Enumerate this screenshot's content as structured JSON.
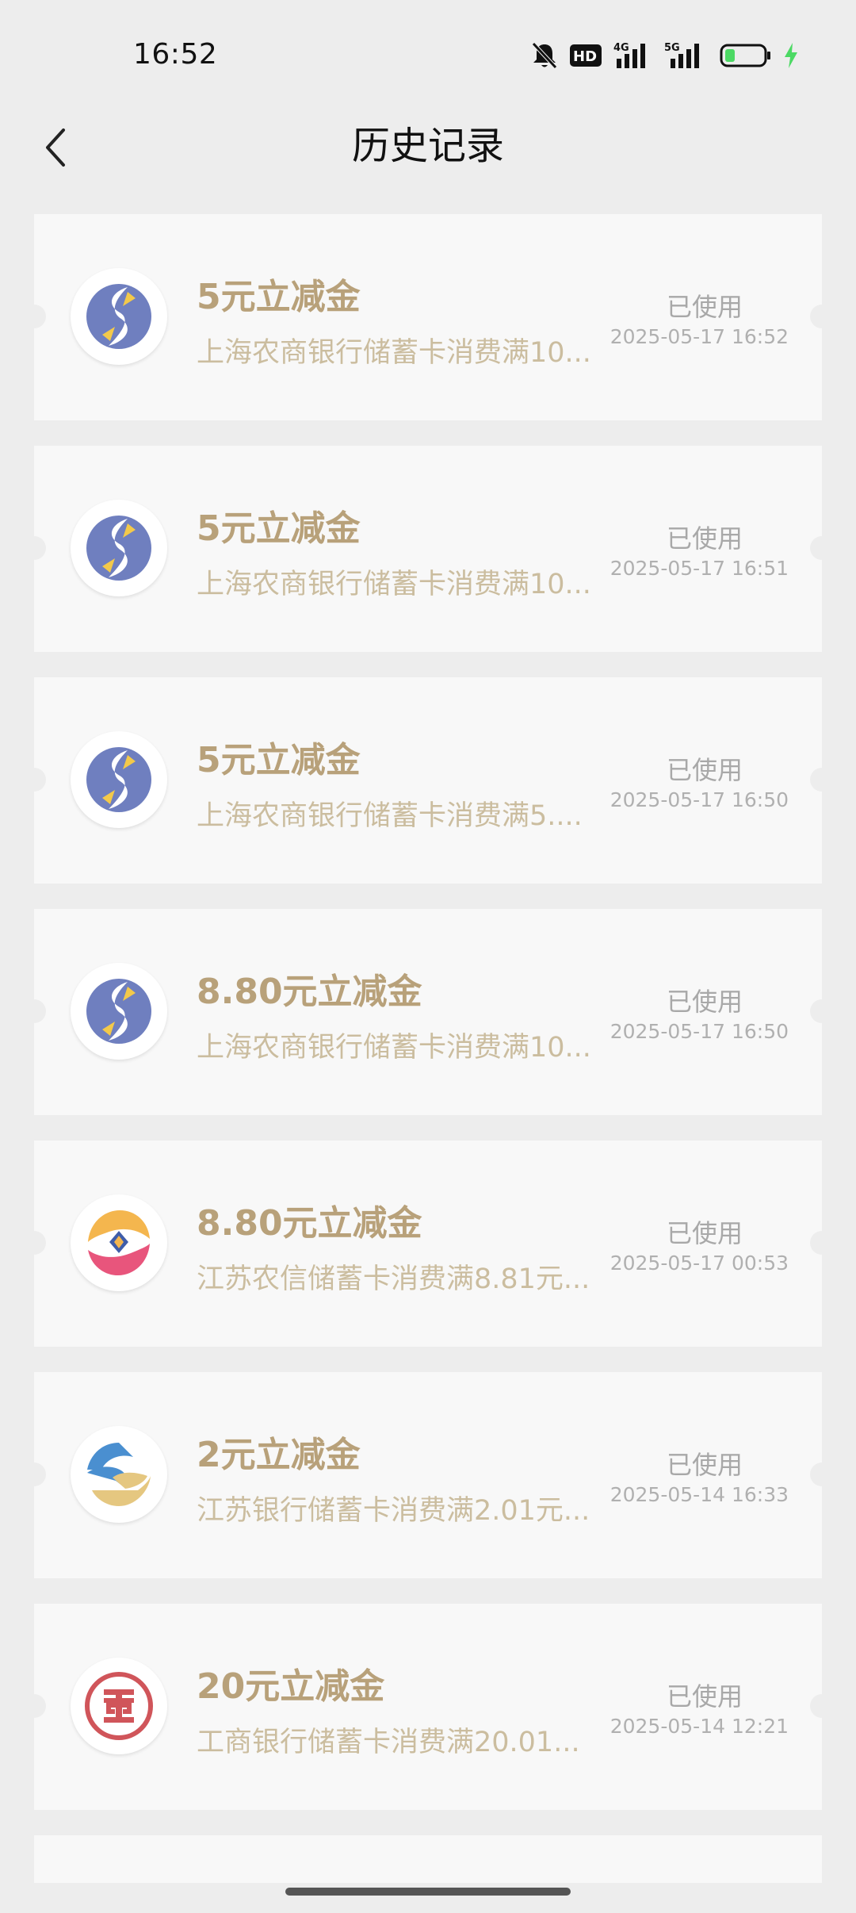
{
  "status_bar": {
    "time": "16:52",
    "icons": [
      "bell-off-icon",
      "hd-icon",
      "signal-4g-icon",
      "signal-5g-icon",
      "battery-icon",
      "charging-icon"
    ],
    "hd_label": "HD",
    "net1_label": "4G",
    "net2_label": "5G",
    "battery_color": "#4cd964"
  },
  "header": {
    "title": "历史记录",
    "back_icon": "chevron-left-icon"
  },
  "colors": {
    "background": "#ededed",
    "card": "#f8f8f8",
    "title_gold": "#b8a17a",
    "desc_gold": "#cbbd9f"
  },
  "coupons": [
    {
      "title": "5元立减金",
      "desc": "上海农商银行储蓄卡消费满10...",
      "status": "已使用",
      "date": "2025-05-17 16:52",
      "bank_icon": "shanghai-rural-bank-logo-icon"
    },
    {
      "title": "5元立减金",
      "desc": "上海农商银行储蓄卡消费满10...",
      "status": "已使用",
      "date": "2025-05-17 16:51",
      "bank_icon": "shanghai-rural-bank-logo-icon"
    },
    {
      "title": "5元立减金",
      "desc": "上海农商银行储蓄卡消费满5....",
      "status": "已使用",
      "date": "2025-05-17 16:50",
      "bank_icon": "shanghai-rural-bank-logo-icon"
    },
    {
      "title": "8.80元立减金",
      "desc": "上海农商银行储蓄卡消费满10...",
      "status": "已使用",
      "date": "2025-05-17 16:50",
      "bank_icon": "shanghai-rural-bank-logo-icon"
    },
    {
      "title": "8.80元立减金",
      "desc": "江苏农信储蓄卡消费满8.81元...",
      "status": "已使用",
      "date": "2025-05-17 00:53",
      "bank_icon": "jiangsu-rural-credit-logo-icon"
    },
    {
      "title": "2元立减金",
      "desc": "江苏银行储蓄卡消费满2.01元...",
      "status": "已使用",
      "date": "2025-05-14 16:33",
      "bank_icon": "bank-of-jiangsu-logo-icon"
    },
    {
      "title": "20元立减金",
      "desc": "工商银行储蓄卡消费满20.01...",
      "status": "已使用",
      "date": "2025-05-14 12:21",
      "bank_icon": "icbc-logo-icon"
    }
  ]
}
